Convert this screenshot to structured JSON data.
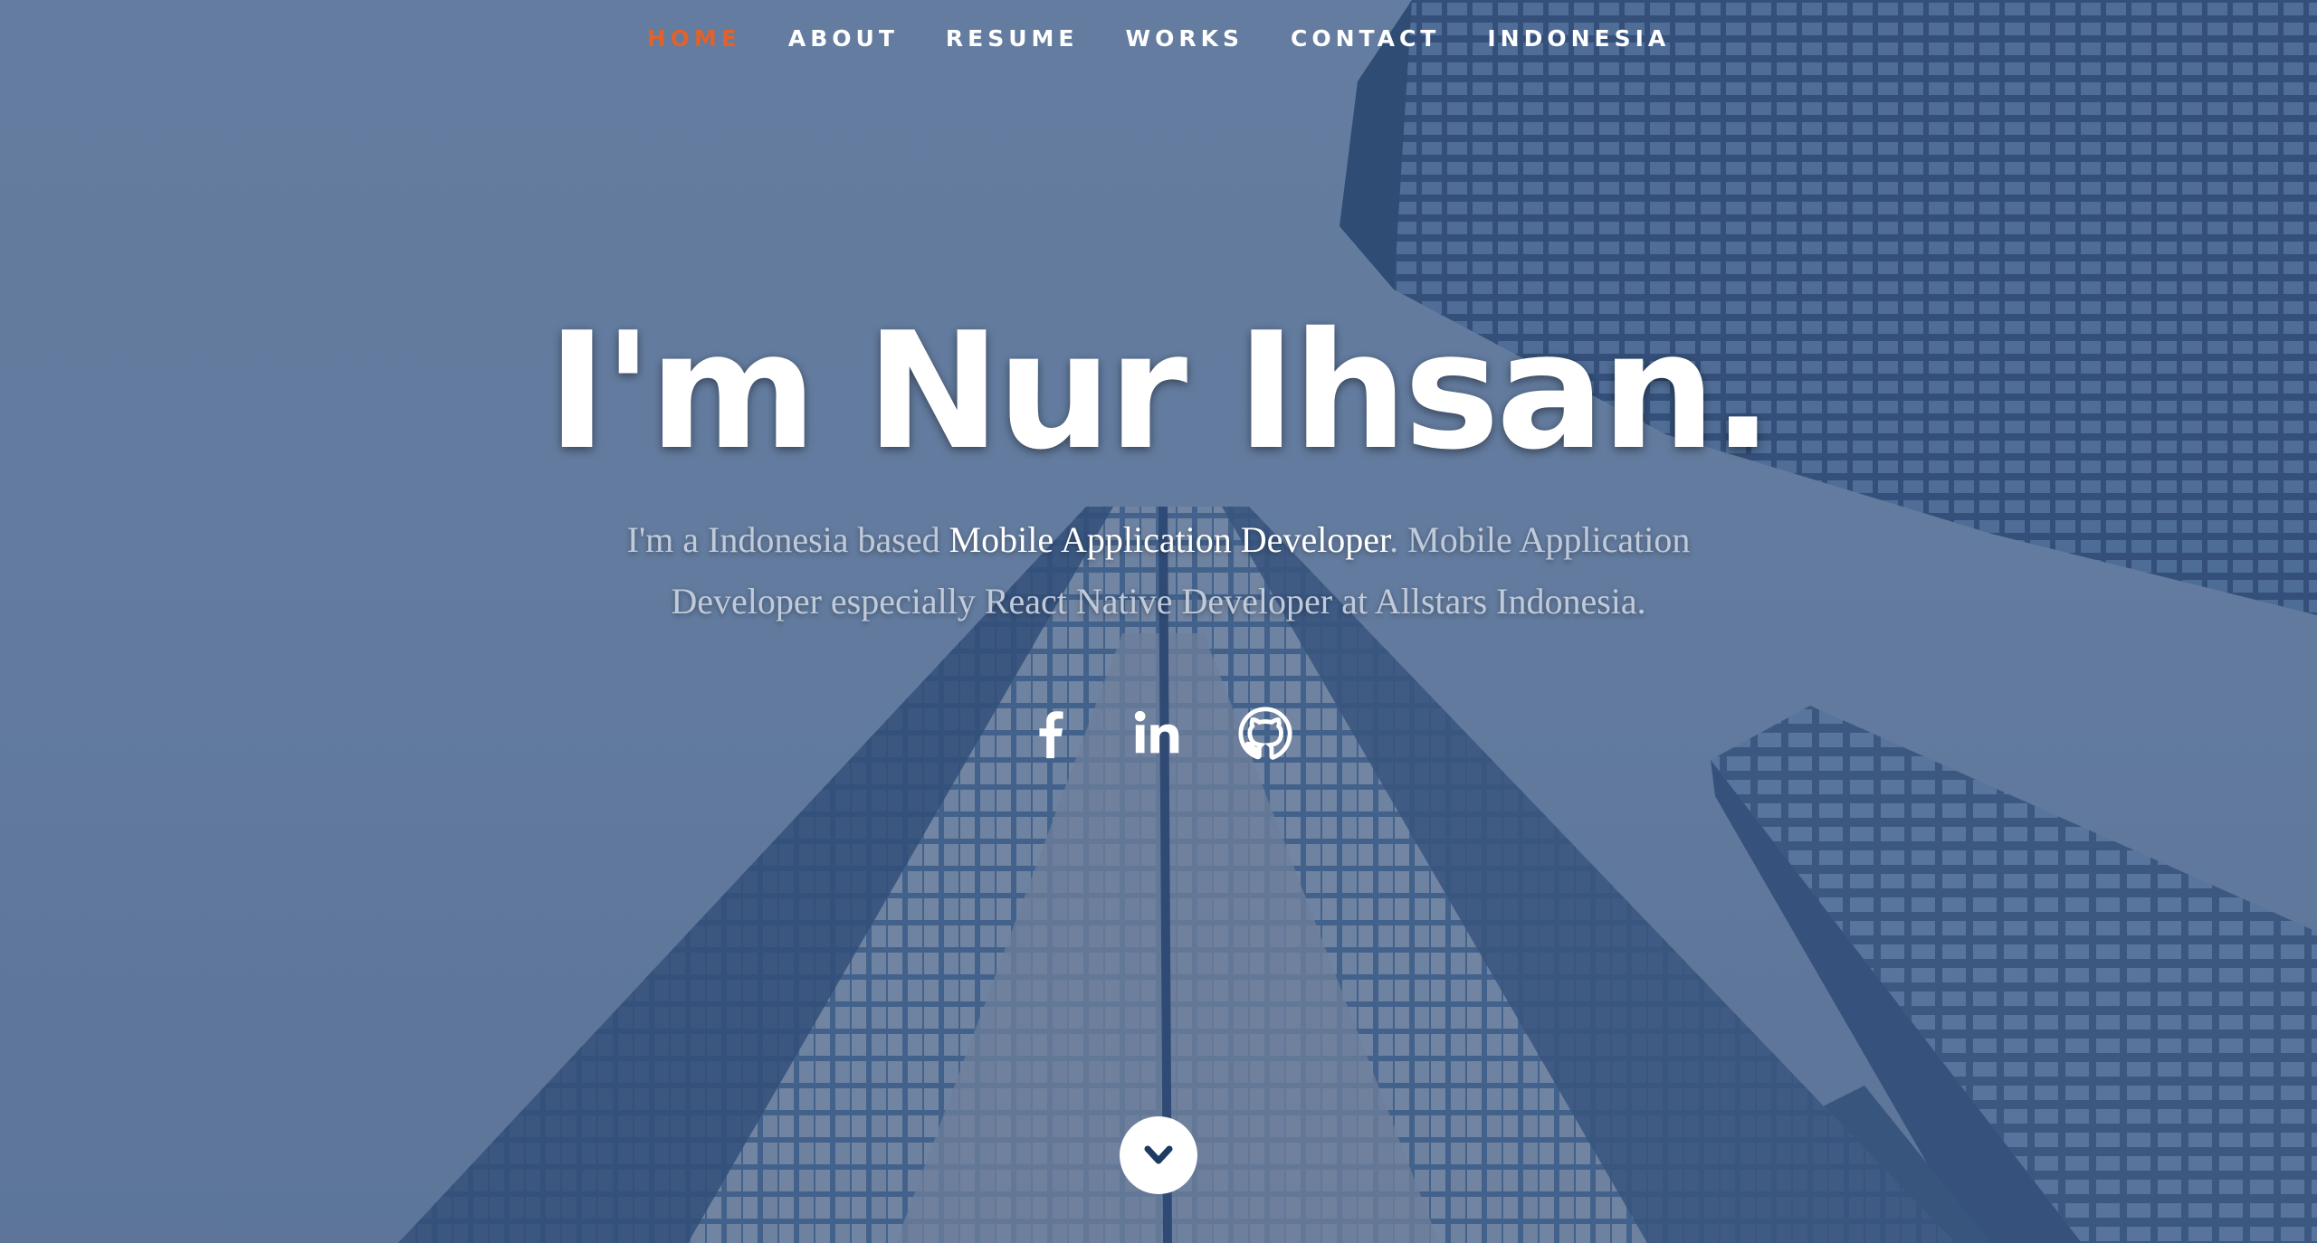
{
  "nav": {
    "items": [
      {
        "label": "HOME",
        "active": true
      },
      {
        "label": "ABOUT",
        "active": false
      },
      {
        "label": "RESUME",
        "active": false
      },
      {
        "label": "WORKS",
        "active": false
      },
      {
        "label": "CONTACT",
        "active": false
      },
      {
        "label": "INDONESIA",
        "active": false
      }
    ],
    "active_color": "#e0622c"
  },
  "banner": {
    "headline": "I'm Nur Ihsan.",
    "tagline_part1": "I'm a Indonesia based ",
    "tagline_highlight": "Mobile Application Developer",
    "tagline_part2": ". Mobile Application Developer especially React Native Developer at Allstars Indonesia."
  },
  "social": [
    {
      "icon": "facebook-icon"
    },
    {
      "icon": "linkedin-icon"
    },
    {
      "icon": "github-icon"
    }
  ],
  "scroll_icon": "chevron-down-icon",
  "colors": {
    "overlay": "#6a81a1",
    "text": "#ffffff",
    "muted_text": "#c0cada"
  }
}
